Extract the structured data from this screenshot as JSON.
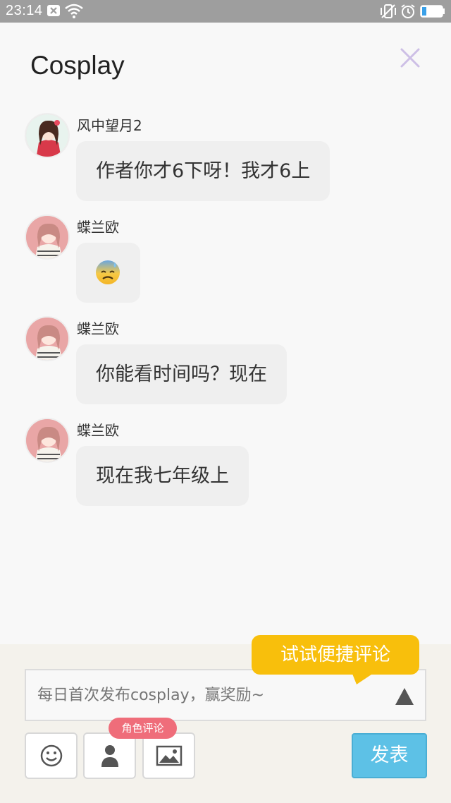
{
  "status_bar": {
    "time": "23:14",
    "icons": [
      "notification-close-icon",
      "wifi-icon",
      "vibrate-icon",
      "alarm-icon",
      "battery-icon"
    ]
  },
  "header": {
    "title": "Cosplay",
    "close_icon": "close-icon"
  },
  "messages": [
    {
      "username": "风中望月2",
      "text": "作者你才6下呀！我才6上",
      "avatar": "avatar-girl-red-kimono"
    },
    {
      "username": "蝶兰欧",
      "text": "😓",
      "avatar": "avatar-girl-pink-hair"
    },
    {
      "username": "蝶兰欧",
      "text": "你能看时间吗？现在",
      "avatar": "avatar-girl-pink-hair"
    },
    {
      "username": "蝶兰欧",
      "text": "现在我七年级上",
      "avatar": "avatar-girl-pink-hair"
    }
  ],
  "compose": {
    "tip": "试试便捷评论",
    "placeholder": "每日首次发布cosplay，赢奖励~",
    "role_badge": "角色评论",
    "tools": [
      "smiley-icon",
      "person-icon",
      "image-icon"
    ],
    "publish_label": "发表"
  },
  "colors": {
    "accent_yellow": "#f8bf0c",
    "publish_blue": "#5dc1e6",
    "badge_pink": "#ef6d7a",
    "close_purple": "#cdbfe6"
  }
}
